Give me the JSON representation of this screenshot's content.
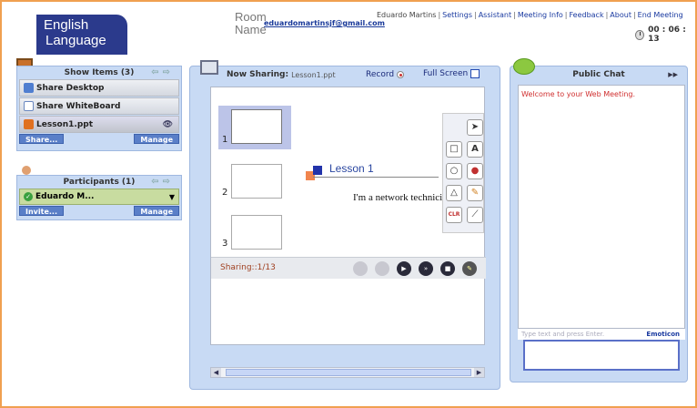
{
  "header": {
    "logo_line1": "English",
    "logo_line2": "Language",
    "room_label": "Room Name",
    "room_email": "eduardomartinsjf@gmail.com",
    "user_name": "Eduardo Martins",
    "nav": [
      "Settings",
      "Assistant",
      "Meeting Info",
      "Feedback",
      "About",
      "End Meeting"
    ],
    "timer": "00 : 06 : 13"
  },
  "items_panel": {
    "title": "Show Items (3)",
    "items": [
      "Share Desktop",
      "Share WhiteBoard",
      "Lesson1.ppt"
    ],
    "share_btn": "Share...",
    "manage_btn": "Manage"
  },
  "participants_panel": {
    "title": "Participants (1)",
    "participant": "Eduardo M...",
    "invite_btn": "Invite...",
    "manage_btn": "Manage"
  },
  "sharing": {
    "now_sharing_label": "Now Sharing:",
    "file": "Lesson1.ppt",
    "record_label": "Record",
    "fullscreen_label": "Full Screen",
    "thumb_numbers": [
      "1",
      "2",
      "3"
    ],
    "slide_title": "Lesson 1",
    "slide_body": "I'm a network technicia",
    "sharing_status": "Sharing::1/13"
  },
  "chat": {
    "title": "Public Chat",
    "welcome": "Welcome to your Web Meeting.",
    "placeholder": "Type text and press Enter.",
    "emoticon_label": "Emoticon"
  },
  "colors": {
    "frame": "#f0a050",
    "panel_bg": "#c8daf4",
    "logo_bg": "#2b3a8c",
    "link": "#1a3aa0",
    "welcome": "#d03030"
  }
}
